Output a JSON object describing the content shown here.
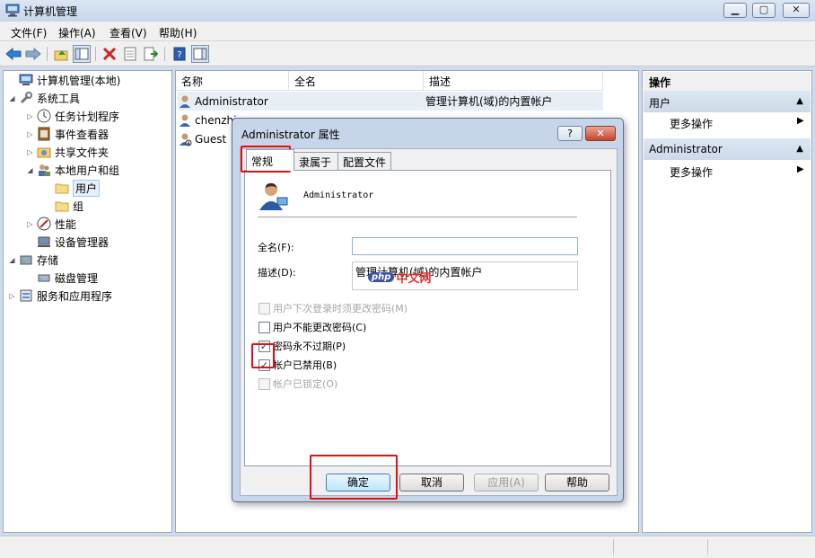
{
  "window": {
    "title": "计算机管理"
  },
  "menu": [
    "文件(F)",
    "操作(A)",
    "查看(V)",
    "帮助(H)"
  ],
  "tree": [
    {
      "label": "计算机管理(本地)",
      "level": 0,
      "icon": "computer-management-icon"
    },
    {
      "label": "系统工具",
      "level": 1,
      "icon": "tools-icon"
    },
    {
      "label": "任务计划程序",
      "level": 2,
      "icon": "clock-icon"
    },
    {
      "label": "事件查看器",
      "level": 2,
      "icon": "event-viewer-icon"
    },
    {
      "label": "共享文件夹",
      "level": 2,
      "icon": "shared-folder-icon"
    },
    {
      "label": "本地用户和组",
      "level": 2,
      "icon": "users-groups-icon"
    },
    {
      "label": "用户",
      "level": 3,
      "icon": "folder-icon"
    },
    {
      "label": "组",
      "level": 3,
      "icon": "folder-icon"
    },
    {
      "label": "性能",
      "level": 2,
      "icon": "performance-icon"
    },
    {
      "label": "设备管理器",
      "level": 2,
      "icon": "device-manager-icon"
    },
    {
      "label": "存储",
      "level": 1,
      "icon": "storage-icon"
    },
    {
      "label": "磁盘管理",
      "level": 2,
      "icon": "disk-icon"
    },
    {
      "label": "服务和应用程序",
      "level": 1,
      "icon": "services-icon"
    }
  ],
  "list": {
    "columns": [
      "名称",
      "全名",
      "描述"
    ],
    "rows": [
      {
        "name": "Administrator",
        "fullname": "",
        "desc": "管理计算机(域)的内置帐户"
      },
      {
        "name": "chenzhi",
        "fullname": "",
        "desc": ""
      },
      {
        "name": "Guest",
        "fullname": "",
        "desc": ""
      }
    ]
  },
  "actions": {
    "header": "操作",
    "sections": [
      {
        "title": "用户",
        "item": "更多操作"
      },
      {
        "title": "Administrator",
        "item": "更多操作"
      }
    ]
  },
  "dialog": {
    "title": "Administrator 属性",
    "help_label": "?",
    "close_label": "✕",
    "tabs": [
      "常规",
      "隶属于",
      "配置文件"
    ],
    "username": "Administrator",
    "fullname_label": "全名(F):",
    "fullname_value": "",
    "desc_label": "描述(D):",
    "desc_value": "管理计算机(域)的内置帐户",
    "checkboxes": [
      {
        "label": "用户下次登录时须更改密码(M)",
        "checked": false,
        "disabled": true
      },
      {
        "label": "用户不能更改密码(C)",
        "checked": false,
        "disabled": false
      },
      {
        "label": "密码永不过期(P)",
        "checked": true,
        "disabled": false
      },
      {
        "label": "帐户已禁用(B)",
        "checked": true,
        "disabled": false
      },
      {
        "label": "帐户已锁定(O)",
        "checked": false,
        "disabled": true
      }
    ],
    "buttons": {
      "ok": "确定",
      "cancel": "取消",
      "apply": "应用(A)",
      "help": "帮助"
    }
  },
  "watermark": {
    "badge": "php",
    "text": "中文网"
  }
}
